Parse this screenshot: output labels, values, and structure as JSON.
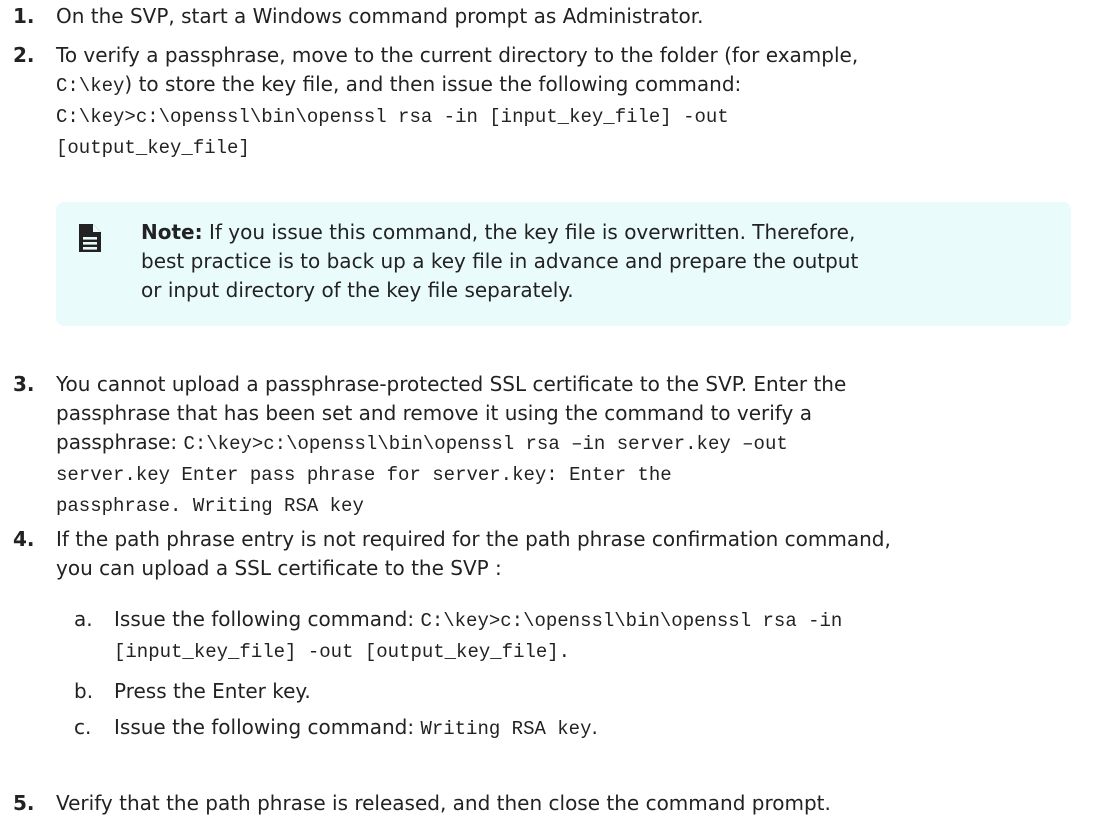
{
  "steps": [
    {
      "num": "1.",
      "lines": [
        [
          {
            "t": "On the SVP, start a Windows command prompt as Administrator."
          }
        ]
      ]
    },
    {
      "num": "2.",
      "lines": [
        [
          {
            "t": "To verify a passphrase, move to the current directory to the folder (for example,"
          }
        ],
        [
          {
            "t": "C:\\key",
            "mono": true
          },
          {
            "t": ") to store the key file, and then issue the following command:"
          }
        ],
        [
          {
            "t": "C:\\key>c:\\openssl\\bin\\openssl rsa -in [input_key_file] -out",
            "mono": true
          }
        ],
        [
          {
            "t": "[output_key_file]",
            "mono": true
          }
        ]
      ]
    },
    {
      "num": "3.",
      "lines": [
        [
          {
            "t": "You cannot upload a passphrase-protected SSL certificate to the SVP. Enter the"
          }
        ],
        [
          {
            "t": "passphrase that has been set and remove it using the command to verify a"
          }
        ],
        [
          {
            "t": "passphrase: "
          },
          {
            "t": "C:\\key>c:\\openssl\\bin\\openssl rsa –in server.key –out",
            "mono": true
          }
        ],
        [
          {
            "t": "server.key Enter pass phrase for server.key: Enter the",
            "mono": true
          }
        ],
        [
          {
            "t": "passphrase. Writing RSA key",
            "mono": true
          }
        ]
      ]
    },
    {
      "num": "4.",
      "lines": [
        [
          {
            "t": "If the path phrase entry is not required for the path phrase confirmation command,"
          }
        ],
        [
          {
            "t": "you can upload a SSL certificate to the SVP :"
          }
        ]
      ]
    },
    {
      "num": "5.",
      "lines": [
        [
          {
            "t": "Verify that the path phrase is released, and then close the command prompt."
          }
        ]
      ]
    }
  ],
  "note": {
    "label": "Note:",
    "lines": [
      "If you issue this command, the key file is overwritten. Therefore,",
      "best practice is to back up a key file in advance and prepare the output",
      "or input directory of the key file separately."
    ]
  },
  "substeps": [
    {
      "letter": "a.",
      "lines": [
        [
          {
            "t": "Issue the following command: "
          },
          {
            "t": "C:\\key>c:\\openssl\\bin\\openssl rsa -in",
            "mono": true
          }
        ],
        [
          {
            "t": "[input_key_file] -out [output_key_file].",
            "mono": true
          }
        ]
      ]
    },
    {
      "letter": "b.",
      "lines": [
        [
          {
            "t": "Press the Enter key."
          }
        ]
      ]
    },
    {
      "letter": "c.",
      "lines": [
        [
          {
            "t": "Issue the following command: "
          },
          {
            "t": "Writing RSA key",
            "mono": true
          },
          {
            "t": "."
          }
        ]
      ]
    }
  ]
}
